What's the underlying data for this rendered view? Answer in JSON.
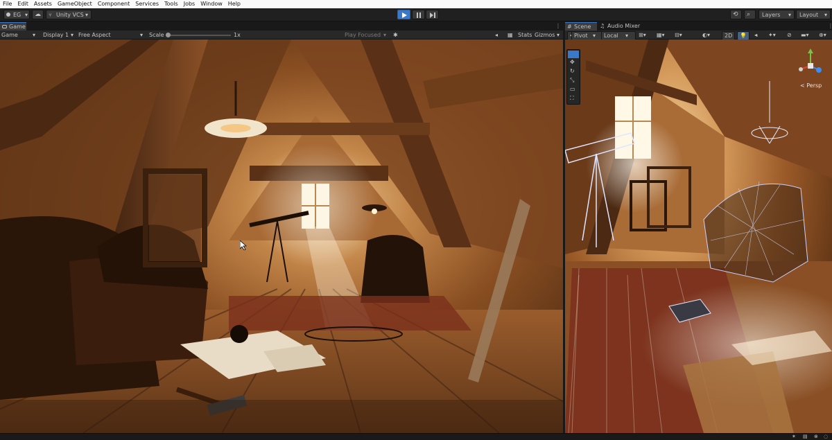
{
  "menu": [
    "File",
    "Edit",
    "Assets",
    "GameObject",
    "Component",
    "Services",
    "Tools",
    "Jobs",
    "Window",
    "Help"
  ],
  "toolbar": {
    "account": "EG",
    "vcs": "Unity VCS",
    "layers": "Layers",
    "layout": "Layout"
  },
  "game_panel": {
    "tab": "Game",
    "mode": "Game",
    "display": "Display 1",
    "aspect": "Free Aspect",
    "scale_label": "Scale",
    "scale_value": "1x",
    "play_focused": "Play Focused",
    "stats": "Stats",
    "gizmos": "Gizmos"
  },
  "scene_panel": {
    "tabs": [
      "Scene",
      "Audio Mixer"
    ],
    "pivot": "Pivot",
    "local": "Local",
    "mode_2d": "2D",
    "persp": "< Persp"
  },
  "colors": {
    "accent": "#3a78c9",
    "panel": "#282828",
    "menubar": "#fafafa"
  }
}
